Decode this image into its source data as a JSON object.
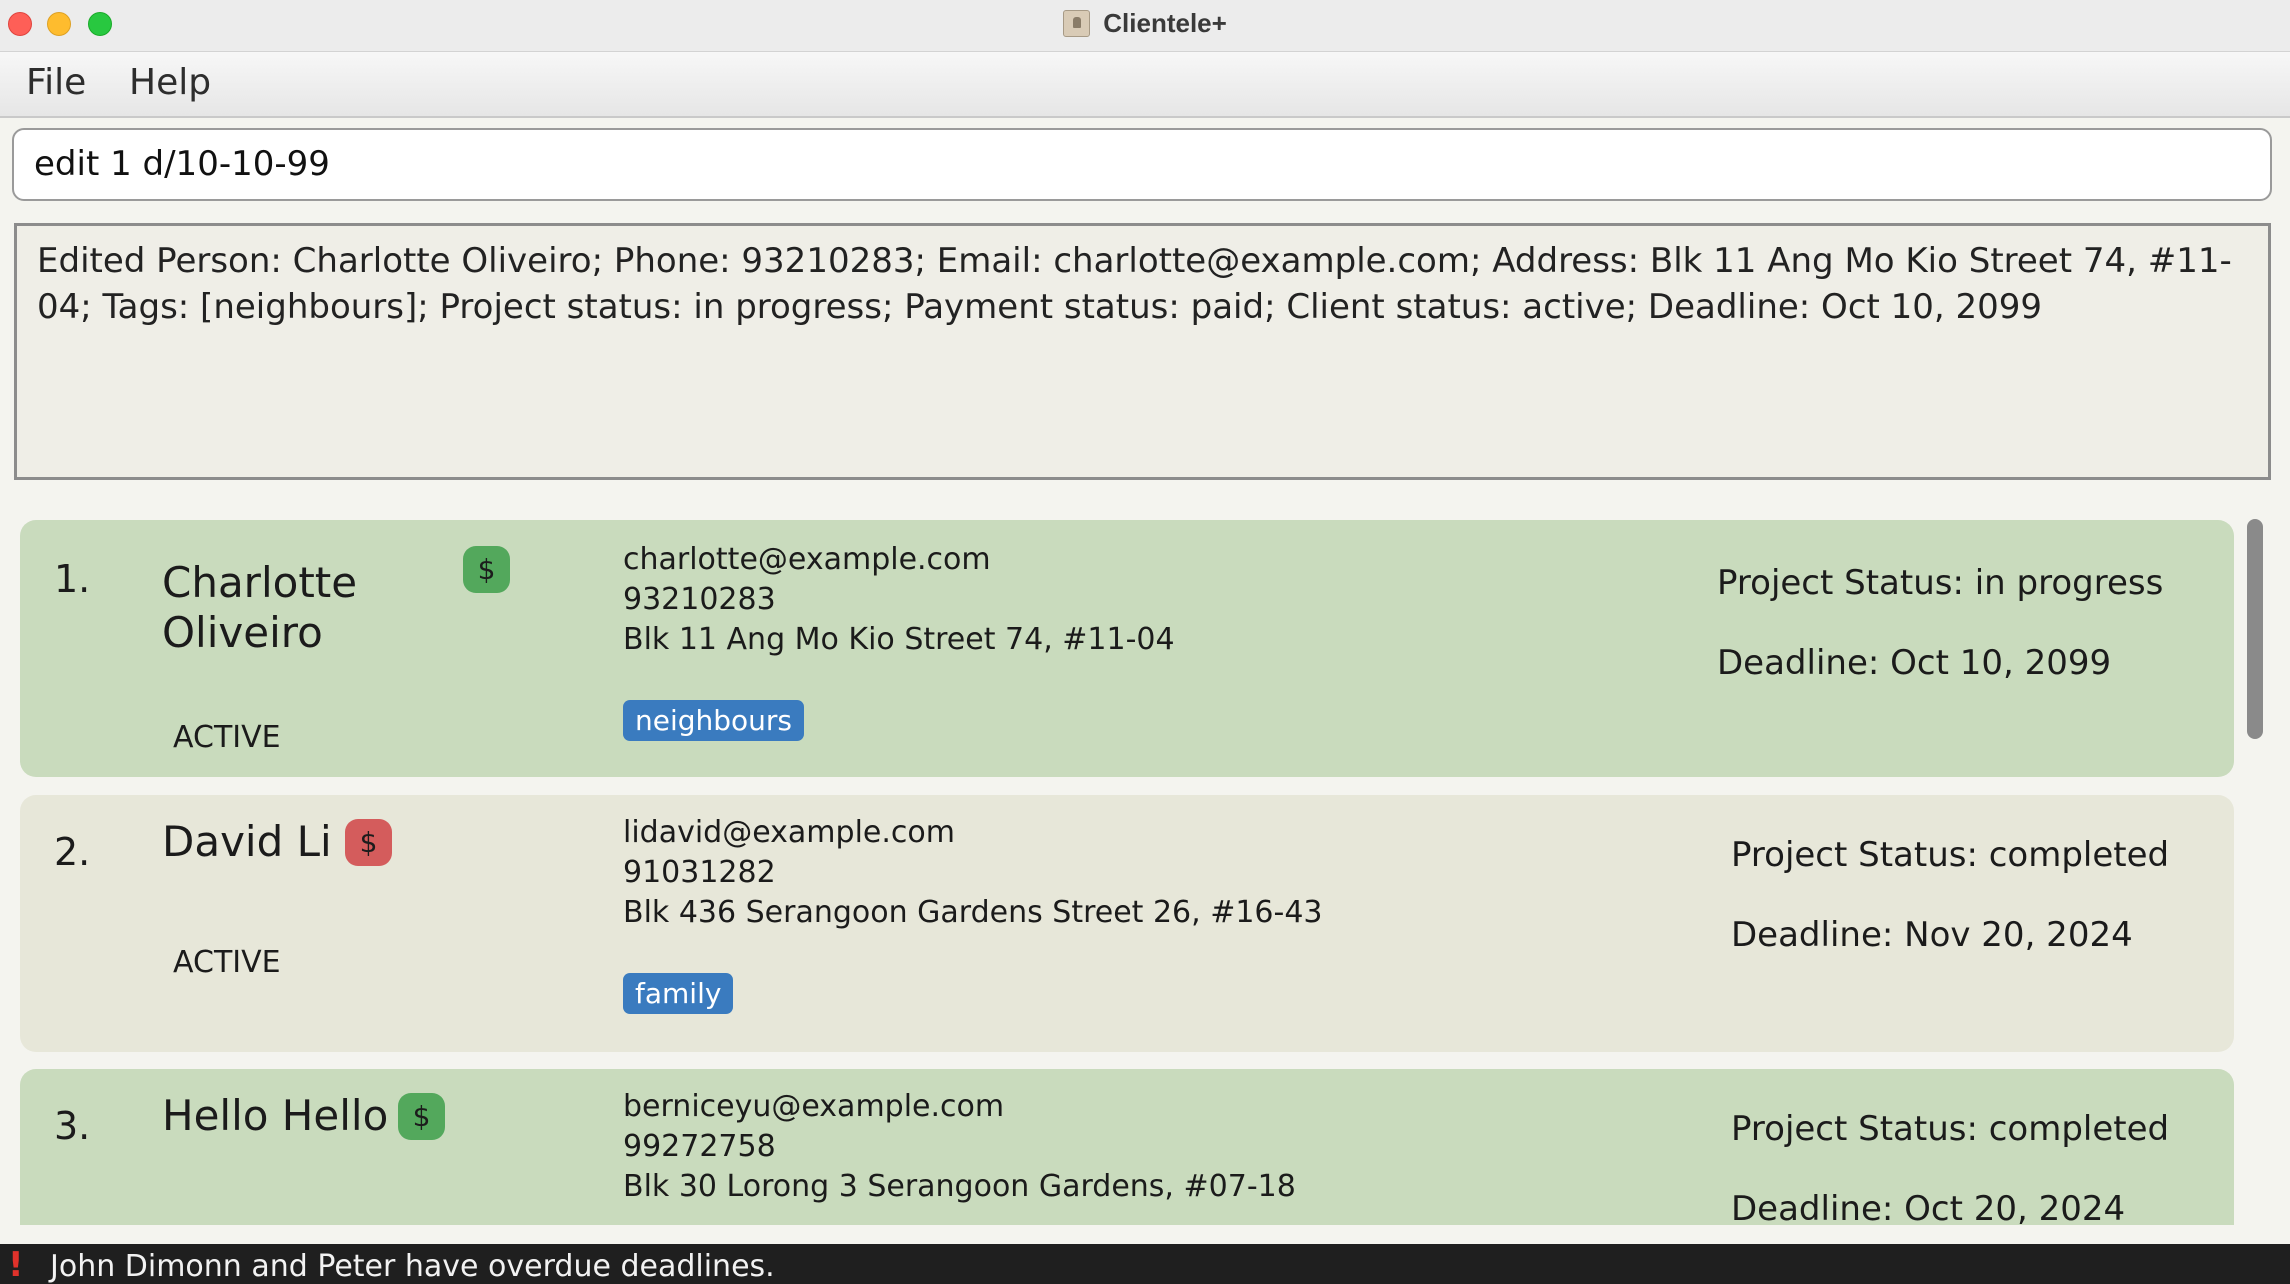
{
  "window": {
    "title": "Clientele+"
  },
  "menu": {
    "file": "File",
    "help": "Help"
  },
  "command": {
    "value": "edit 1 d/10-10-99"
  },
  "result": {
    "text": "Edited Person: Charlotte Oliveiro; Phone: 93210283; Email: charlotte@example.com; Address: Blk 11 Ang Mo Kio Street 74, #11-04; Tags: [neighbours]; Project status: in progress; Payment status: paid; Client status: active; Deadline: Oct 10, 2099"
  },
  "people": [
    {
      "index": "1.",
      "name_line1": "Charlotte",
      "name_line2": "Oliveiro",
      "payment_symbol": "$",
      "payment_color": "#53a85c",
      "client_status": "ACTIVE",
      "email": "charlotte@example.com",
      "phone": "93210283",
      "address": "Blk 11 Ang Mo Kio Street 74, #11-04",
      "tag": "neighbours",
      "project_status": "Project Status: in progress",
      "deadline": "Deadline: Oct 10, 2099"
    },
    {
      "index": "2.",
      "name": "David Li",
      "payment_symbol": "$",
      "payment_color": "#d45c5c",
      "client_status": "ACTIVE",
      "email": "lidavid@example.com",
      "phone": "91031282",
      "address": "Blk 436 Serangoon Gardens Street 26, #16-43",
      "tag": "family",
      "project_status": "Project Status: completed",
      "deadline": "Deadline: Nov 20, 2024"
    },
    {
      "index": "3.",
      "name": "Hello Hello",
      "payment_symbol": "$",
      "payment_color": "#53a85c",
      "email": "berniceyu@example.com",
      "phone": "99272758",
      "address": "Blk 30 Lorong 3 Serangoon Gardens, #07-18",
      "project_status": "Project Status: completed",
      "deadline": "Deadline: Oct 20, 2024"
    }
  ],
  "status_bar": {
    "icon": "exclamation-icon",
    "text": "John Dimonn and Peter have overdue deadlines."
  }
}
